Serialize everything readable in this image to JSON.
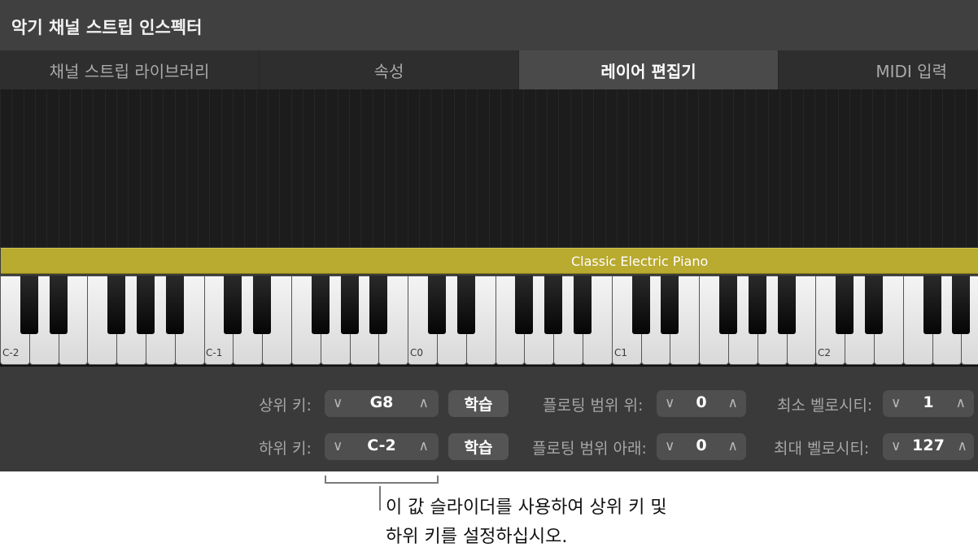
{
  "window": {
    "title": "악기 채널 스트립 인스펙터"
  },
  "tabs": [
    {
      "label": "채널 스트립 라이브러리"
    },
    {
      "label": "속성"
    },
    {
      "label": "레이어 편집기"
    },
    {
      "label": "MIDI 입력"
    }
  ],
  "active_tab": "레이어 편집기",
  "layer": {
    "name": "Classic Electric Piano"
  },
  "keyboard": {
    "octave_labels": [
      "C-2",
      "C-1",
      "C0",
      "C1",
      "C2"
    ]
  },
  "controls": {
    "upper_key": {
      "label": "상위 키:",
      "value": "G8",
      "learn": "학습"
    },
    "lower_key": {
      "label": "하위 키:",
      "value": "C-2",
      "learn": "학습"
    },
    "floating_range_up": {
      "label": "플로팅 범위 위:",
      "value": "0"
    },
    "floating_range_down": {
      "label": "플로팅 범위 아래:",
      "value": "0"
    },
    "min_velocity": {
      "label": "최소 벨로시티:",
      "value": "1"
    },
    "max_velocity": {
      "label": "최대 벨로시티:",
      "value": "127"
    }
  },
  "callout": {
    "line1": "이 값 슬라이더를 사용하여 상위 키 및",
    "line2": "하위 키를 설정하십시오."
  },
  "icons": {
    "decrement": "chevron-down-icon",
    "increment": "chevron-up-icon"
  },
  "colors": {
    "layer_bar": "#b9aa30",
    "panel": "#3b3b3b"
  }
}
